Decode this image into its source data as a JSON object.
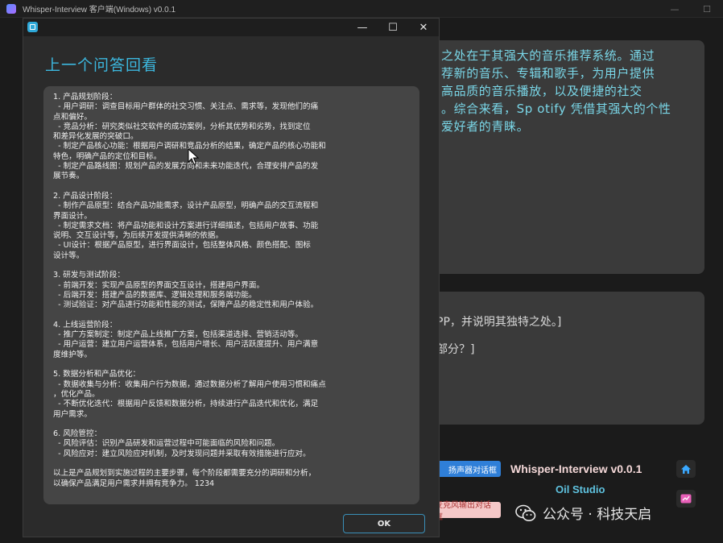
{
  "main_window": {
    "title": "Whisper-Interview 客户端(Windows) v0.0.1",
    "controls": {
      "minimize": "—",
      "maximize": "☐"
    }
  },
  "answer_panel": {
    "text": "之处在于其强大的音乐推荐系统。通过\n荐新的音乐、专辑和歌手，为用户提供\n高品质的音乐播放，以及便捷的社交\n。综合来看，Sp otify 凭借其强大的个性\n爱好者的青睐。"
  },
  "question_panel": {
    "line1": "PP，并说明其独特之处。]",
    "line2": "部分？]"
  },
  "footer": {
    "speaker_button": "扬声器对话框",
    "mic_button": "麦克风输出对话框",
    "brand_title": "Whisper-Interview v0.0.1",
    "brand_subtitle": "Oil Studio",
    "home_icon": "home-icon",
    "chart_icon": "chart-icon"
  },
  "watermark": {
    "text": "公众号 · 科技天启"
  },
  "dialog": {
    "controls": {
      "minimize": "—",
      "maximize": "☐",
      "close": "✕"
    },
    "heading": "上一个问答回看",
    "content": "1. 产品规划阶段：\n  - 用户调研：调查目标用户群体的社交习惯、关注点、需求等，发现他们的痛\n点和偏好。\n  - 竞品分析：研究类似社交软件的成功案例，分析其优势和劣势，找到定位\n和差异化发展的突破口。\n  - 制定产品核心功能：根据用户调研和竞品分析的结果，确定产品的核心功能和\n特色，明确产品的定位和目标。\n  - 制定产品路线图：规划产品的发展方向和未来功能迭代，合理安排产品的发\n展节奏。\n\n2. 产品设计阶段：\n  - 制作产品原型：结合产品功能需求，设计产品原型，明确产品的交互流程和\n界面设计。\n  - 制定需求文档：将产品功能和设计方案进行详细描述，包括用户故事、功能\n说明、交互设计等，为后续开发提供清晰的依据。\n  - UI设计：根据产品原型，进行界面设计，包括整体风格、颜色搭配、图标\n设计等。\n\n3. 研发与测试阶段：\n  - 前端开发：实现产品原型的界面交互设计，搭建用户界面。\n  - 后端开发：搭建产品的数据库、逻辑处理和服务端功能。\n  - 测试验证：对产品进行功能和性能的测试，保障产品的稳定性和用户体验。\n\n4. 上线运营阶段：\n  - 推广方案制定：制定产品上线推广方案，包括渠道选择、营销活动等。\n  - 用户运营：建立用户运营体系，包括用户增长、用户活跃度提升、用户满意\n度维护等。\n\n5. 数据分析和产品优化：\n  - 数据收集与分析：收集用户行为数据，通过数据分析了解用户使用习惯和痛点\n，优化产品。\n  - 不断优化迭代：根据用户反馈和数据分析，持续进行产品迭代和优化，满足\n用户需求。\n\n6. 风险管控：\n  - 风险评估：识别产品研发和运营过程中可能面临的风险和问题。\n  - 风险应对：建立风险应对机制，及时发现问题并采取有效措施进行应对。\n\n以上是产品规划到实施过程的主要步骤，每个阶段都需要充分的调研和分析，\n以确保产品满足用户需求并拥有竞争力。 1234",
    "ok_button": "OK"
  }
}
